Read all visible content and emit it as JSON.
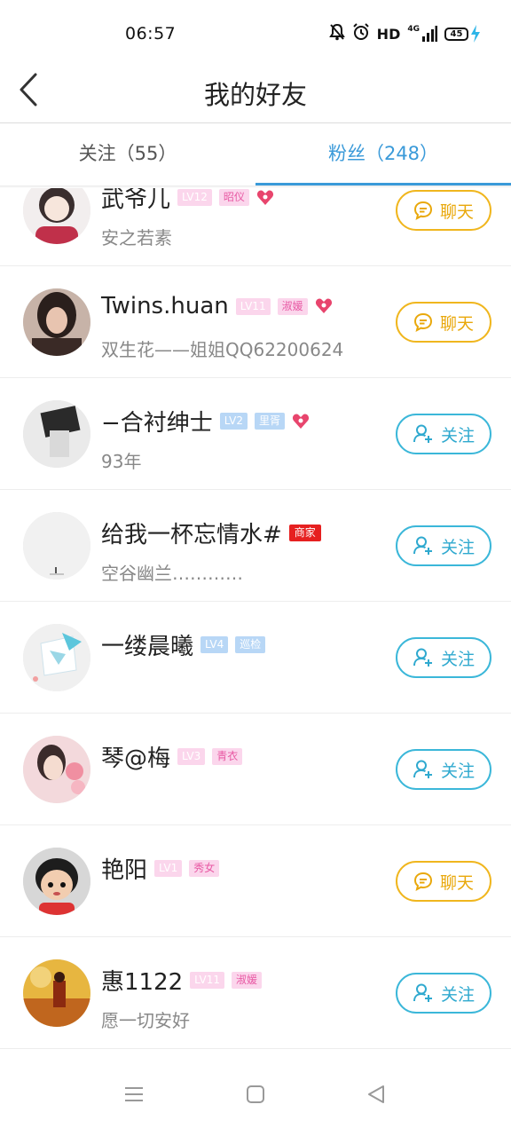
{
  "status_bar": {
    "time": "06:57",
    "network": "HD",
    "signal": "4G",
    "battery": "45",
    "icons": [
      "bell-off-icon",
      "alarm-icon",
      "signal-icon",
      "battery-icon",
      "charging-icon"
    ]
  },
  "header": {
    "title": "我的好友",
    "back_icon": "back-chevron-icon"
  },
  "tabs": [
    {
      "label": "关注（55）",
      "active": false
    },
    {
      "label": "粉丝（248）",
      "active": true
    }
  ],
  "colors": {
    "accent": "#3a9ad9",
    "chat": "#e9a80b",
    "follow": "#2fa9cf",
    "heart": "#e8456d",
    "merchant": "#e62020"
  },
  "friends": [
    {
      "name": "武爷儿",
      "level": "LV12",
      "title": "昭仪",
      "heart": true,
      "subtitle": "安之若素",
      "action": "聊天",
      "action_type": "chat"
    },
    {
      "name": "Twins.huan",
      "level": "LV11",
      "title": "淑媛",
      "heart": true,
      "subtitle": "双生花——姐姐QQ62200624",
      "action": "聊天",
      "action_type": "chat"
    },
    {
      "name": "−合衬绅士",
      "level": "LV2",
      "title": "里胥",
      "heart": true,
      "subtitle": "93年",
      "action": "关注",
      "action_type": "follow"
    },
    {
      "name": "给我一杯忘情水#",
      "merchant": "商家",
      "subtitle": "空谷幽兰…………",
      "action": "关注",
      "action_type": "follow"
    },
    {
      "name": "一缕晨曦",
      "level": "LV4",
      "title": "巡检",
      "subtitle": "",
      "action": "关注",
      "action_type": "follow"
    },
    {
      "name": "琴@梅",
      "level": "LV3",
      "title": "青衣",
      "subtitle": "",
      "action": "关注",
      "action_type": "follow"
    },
    {
      "name": "艳阳",
      "level": "LV1",
      "title": "秀女",
      "subtitle": "",
      "action": "聊天",
      "action_type": "chat"
    },
    {
      "name": "惠1122",
      "level": "LV11",
      "title": "淑媛",
      "subtitle": "愿一切安好",
      "action": "关注",
      "action_type": "follow"
    }
  ],
  "nav_bar": {
    "icons": [
      "menu-icon",
      "home-square-icon",
      "back-triangle-icon"
    ]
  }
}
